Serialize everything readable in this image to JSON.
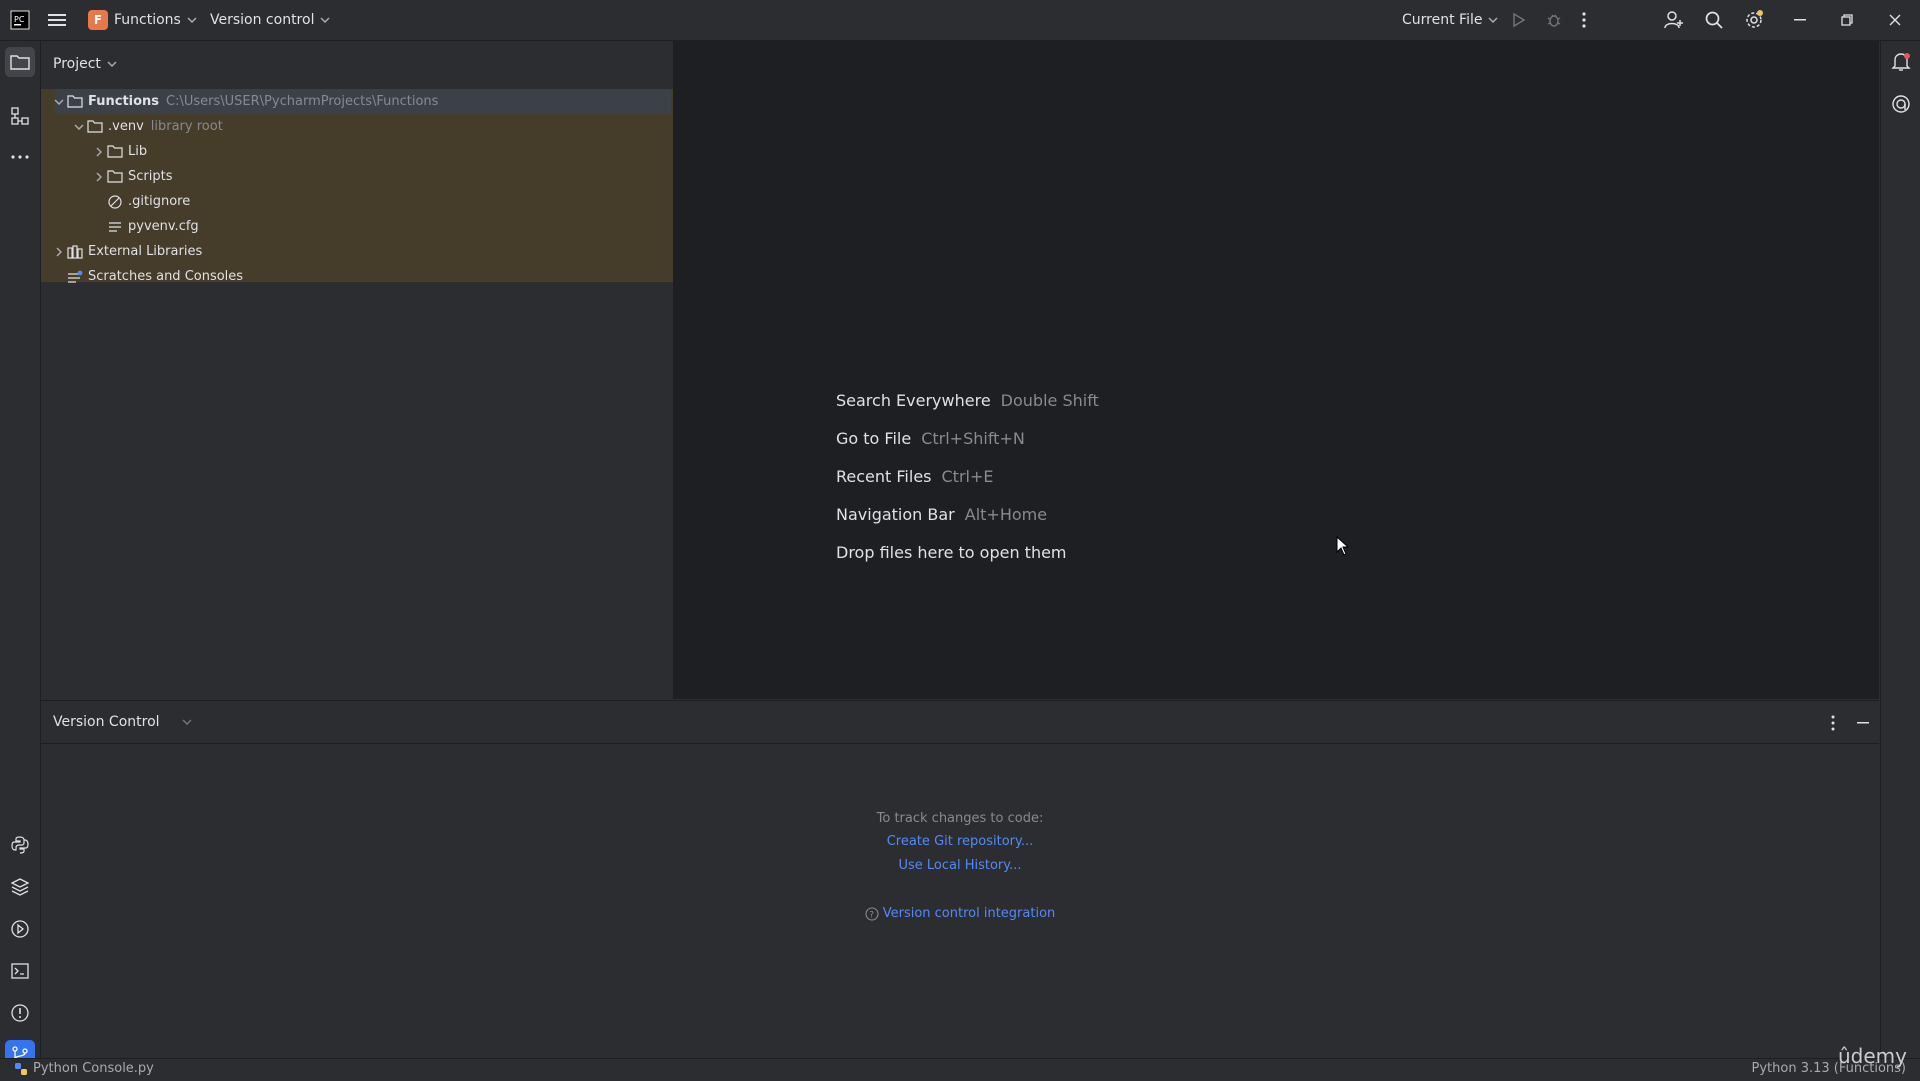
{
  "titlebar": {
    "project_initial": "F",
    "project_name": "Functions",
    "vcs_label": "Version control",
    "run_config": "Current File"
  },
  "project_panel": {
    "title": "Project",
    "tree": [
      {
        "label": "Functions",
        "extra": "C:\\Users\\USER\\PycharmProjects\\Functions"
      },
      {
        "label": ".venv",
        "extra": "library root"
      },
      {
        "label": "Lib",
        "extra": ""
      },
      {
        "label": "Scripts",
        "extra": ""
      },
      {
        "label": ".gitignore",
        "extra": ""
      },
      {
        "label": "pyvenv.cfg",
        "extra": ""
      },
      {
        "label": "External Libraries",
        "extra": ""
      },
      {
        "label": "Scratches and Consoles",
        "extra": ""
      }
    ]
  },
  "editor": {
    "hints": [
      {
        "action": "Search Everywhere",
        "shortcut": "Double Shift"
      },
      {
        "action": "Go to File",
        "shortcut": "Ctrl+Shift+N"
      },
      {
        "action": "Recent Files",
        "shortcut": "Ctrl+E"
      },
      {
        "action": "Navigation Bar",
        "shortcut": "Alt+Home"
      },
      {
        "action": "Drop files here to open them",
        "shortcut": ""
      }
    ]
  },
  "version_control": {
    "title": "Version Control",
    "prompt": "To track changes to code:",
    "create_git": "Create Git repository...",
    "local_history": "Use Local History...",
    "integration": "Version control integration"
  },
  "statusbar": {
    "left": "Python Console.py",
    "right": "Python 3.13 (Functions)"
  },
  "watermark": "ûdemy",
  "colors": {
    "accent": "#548af7",
    "project_icon": "#e8784a",
    "notification_dot": "#e55765",
    "settings_dot": "#f2c55c"
  }
}
